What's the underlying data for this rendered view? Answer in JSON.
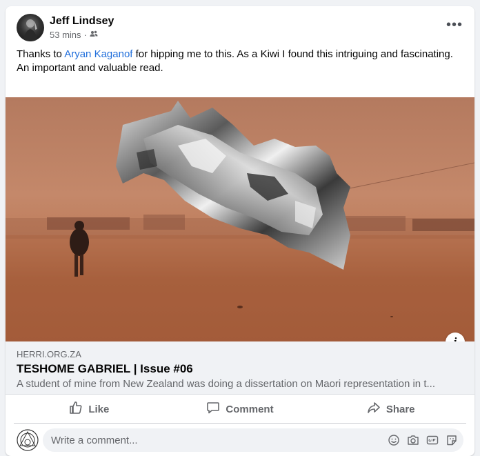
{
  "post": {
    "author": "Jeff Lindsey",
    "time": "53 mins",
    "separator": "·",
    "privacy_icon": "friends-icon",
    "more_icon": "more-horizontal-icon",
    "text_before_mention": "Thanks to ",
    "mention": "Aryan Kaganof",
    "text_after_mention": " for hipping me to this. As a Kiwi I found this intriguing and fascinating.",
    "text_line2": "An important and valuable read."
  },
  "link_preview": {
    "domain": "HERRI.ORG.ZA",
    "title": "TESHOME GABRIEL | Issue #06",
    "description": "A student of mine from New Zealand was doing a dissertation on Maori representation in t...",
    "info_label": "i"
  },
  "actions": {
    "like": "Like",
    "comment": "Comment",
    "share": "Share"
  },
  "comment_box": {
    "placeholder": "Write a comment..."
  },
  "colors": {
    "mention": "#216fdb",
    "secondary_text": "#65676b",
    "card_bg": "#ffffff",
    "page_bg": "#f0f2f5"
  }
}
